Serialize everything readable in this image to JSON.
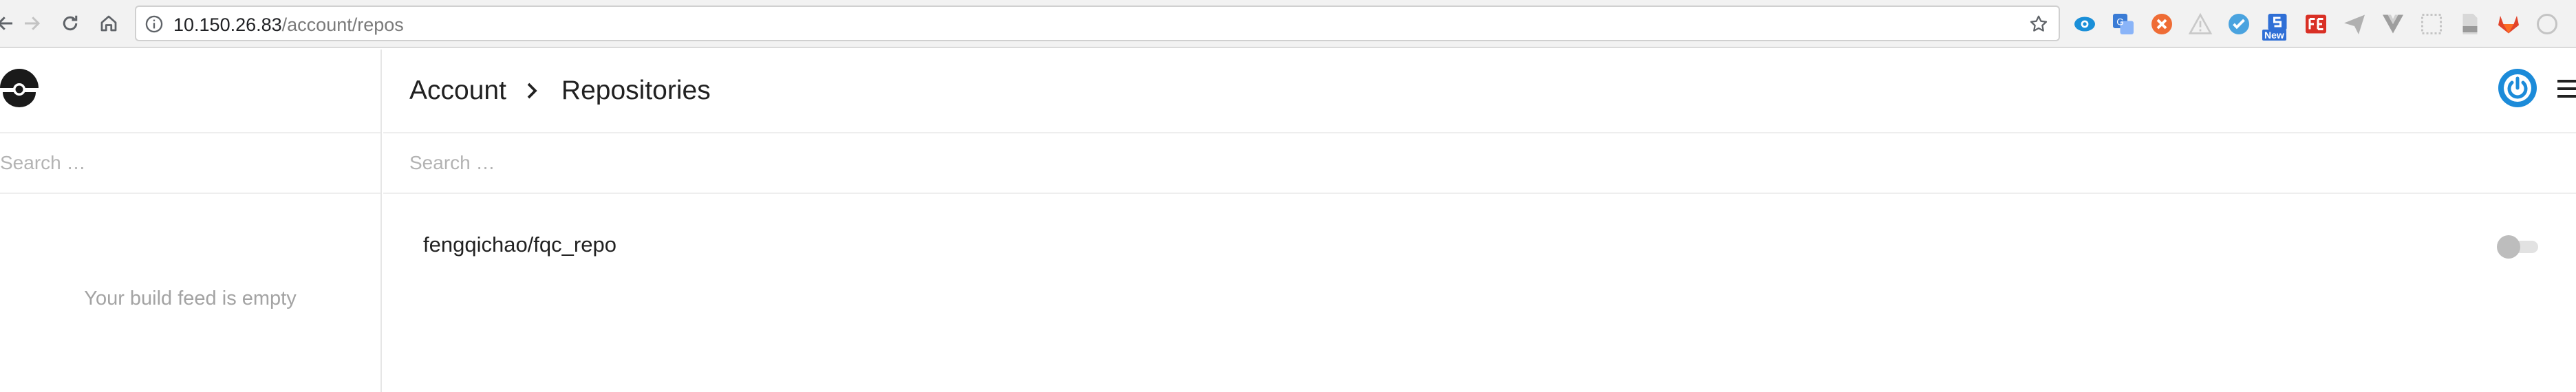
{
  "browser": {
    "url_host": "10.150.26.83",
    "url_path": "/account/repos",
    "extensions": [
      {
        "icon": "eye-extension-icon",
        "color": "#1a8fd8"
      },
      {
        "icon": "translate-extension-icon",
        "color": "#3a7bd5"
      },
      {
        "icon": "x-circle-extension-icon",
        "color": "#ef6c35"
      },
      {
        "icon": "warning-extension-icon",
        "color": "#c9c9c9"
      },
      {
        "icon": "check-bubble-extension-icon",
        "color": "#4aa3df"
      },
      {
        "icon": "s-extension-icon",
        "color": "#2f6fd6",
        "badge": "New"
      },
      {
        "icon": "fe-extension-icon",
        "color": "#d93025"
      },
      {
        "icon": "paper-plane-extension-icon",
        "color": "#b0b0b0"
      },
      {
        "icon": "vue-extension-icon",
        "color": "#9e9e9e"
      },
      {
        "icon": "dotted-box-extension-icon",
        "color": "#c4c4c4"
      },
      {
        "icon": "pdf-extension-icon",
        "color": "#b5b5b5"
      },
      {
        "icon": "gitlab-extension-icon",
        "color": "#e2432a"
      },
      {
        "icon": "circle-outline-extension-icon",
        "color": "#c4c4c4"
      }
    ]
  },
  "sidebar": {
    "search_placeholder": "Search …",
    "empty_message": "Your build feed is empty"
  },
  "header": {
    "breadcrumb": [
      "Account",
      "Repositories"
    ]
  },
  "main": {
    "search_placeholder": "Search …",
    "repos": [
      {
        "name": "fengqichao/fqc_repo",
        "active": false
      }
    ]
  },
  "colors": {
    "accent": "#1c8bd9",
    "toggle_off": "#bdbdbd"
  }
}
